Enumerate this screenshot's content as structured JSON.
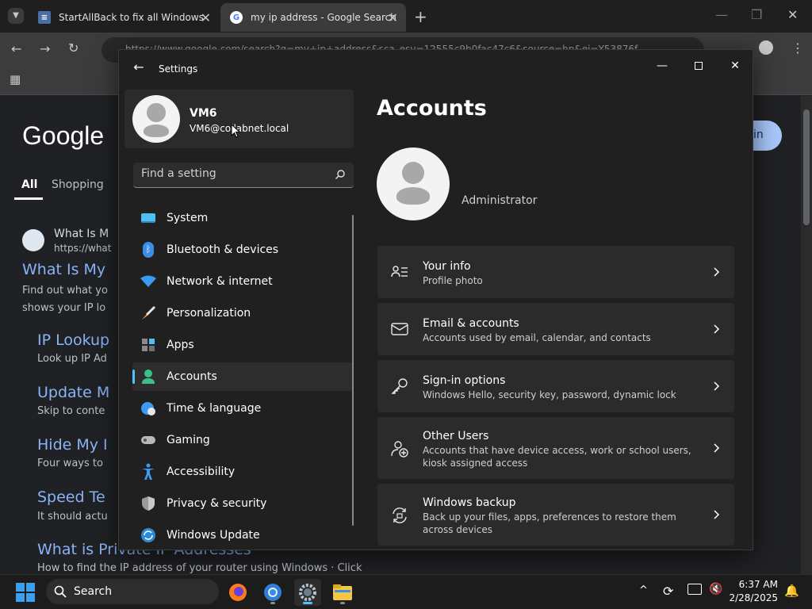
{
  "browser": {
    "tabs": [
      {
        "title": "StartAllBack to fix all Windows"
      },
      {
        "title": "my ip address - Google Search"
      }
    ],
    "url": "https://www.google.com/search?q=my+ip+address&sca_esv=12555c9b0fac47c6&source=hp&ei=Y53876f",
    "google": {
      "logo": "Google",
      "tabs": [
        "All",
        "Shopping"
      ],
      "signin": "in",
      "results": [
        {
          "site": "What Is M",
          "url": "https://what",
          "title": "What Is My",
          "snippet1": "Find out what yo",
          "snippet2": "shows your IP lo"
        },
        {
          "title": "IP Lookup",
          "snippet": "Look up IP Ad"
        },
        {
          "title": "Update M",
          "snippet": "Skip to conte"
        },
        {
          "title": "Hide My I",
          "snippet": "Four ways to"
        },
        {
          "title": "Speed Te",
          "snippet": "It should actu"
        },
        {
          "title": "What is Private IP Addresses",
          "snippet": "How to find the IP address of your router using Windows · Click"
        }
      ]
    }
  },
  "settings": {
    "window_title": "Settings",
    "profile": {
      "name": "VM6",
      "email": "VM6@collabnet.local"
    },
    "search_placeholder": "Find a setting",
    "nav": [
      {
        "label": "System",
        "icon": "monitor-icon",
        "selected": false
      },
      {
        "label": "Bluetooth & devices",
        "icon": "bluetooth-icon",
        "selected": false
      },
      {
        "label": "Network & internet",
        "icon": "wifi-icon",
        "selected": false
      },
      {
        "label": "Personalization",
        "icon": "brush-icon",
        "selected": false
      },
      {
        "label": "Apps",
        "icon": "apps-icon",
        "selected": false
      },
      {
        "label": "Accounts",
        "icon": "person-icon",
        "selected": true
      },
      {
        "label": "Time & language",
        "icon": "globe-clock-icon",
        "selected": false
      },
      {
        "label": "Gaming",
        "icon": "controller-icon",
        "selected": false
      },
      {
        "label": "Accessibility",
        "icon": "accessibility-icon",
        "selected": false
      },
      {
        "label": "Privacy & security",
        "icon": "shield-icon",
        "selected": false
      },
      {
        "label": "Windows Update",
        "icon": "update-icon",
        "selected": false
      }
    ],
    "page_title": "Accounts",
    "account_role": "Administrator",
    "cards": [
      {
        "title": "Your info",
        "desc": "Profile photo",
        "icon": "person-list-icon"
      },
      {
        "title": "Email & accounts",
        "desc": "Accounts used by email, calendar, and contacts",
        "icon": "mail-icon"
      },
      {
        "title": "Sign-in options",
        "desc": "Windows Hello, security key, password, dynamic lock",
        "icon": "key-icon"
      },
      {
        "title": "Other Users",
        "desc": "Accounts that have device access, work or school users, kiosk assigned access",
        "icon": "person-add-icon"
      },
      {
        "title": "Windows backup",
        "desc": "Back up your files, apps, preferences to restore them across devices",
        "icon": "backup-icon"
      }
    ],
    "accent": "#4cc2ff"
  },
  "taskbar": {
    "search_label": "Search",
    "time": "6:37 AM",
    "date": "2/28/2025"
  }
}
